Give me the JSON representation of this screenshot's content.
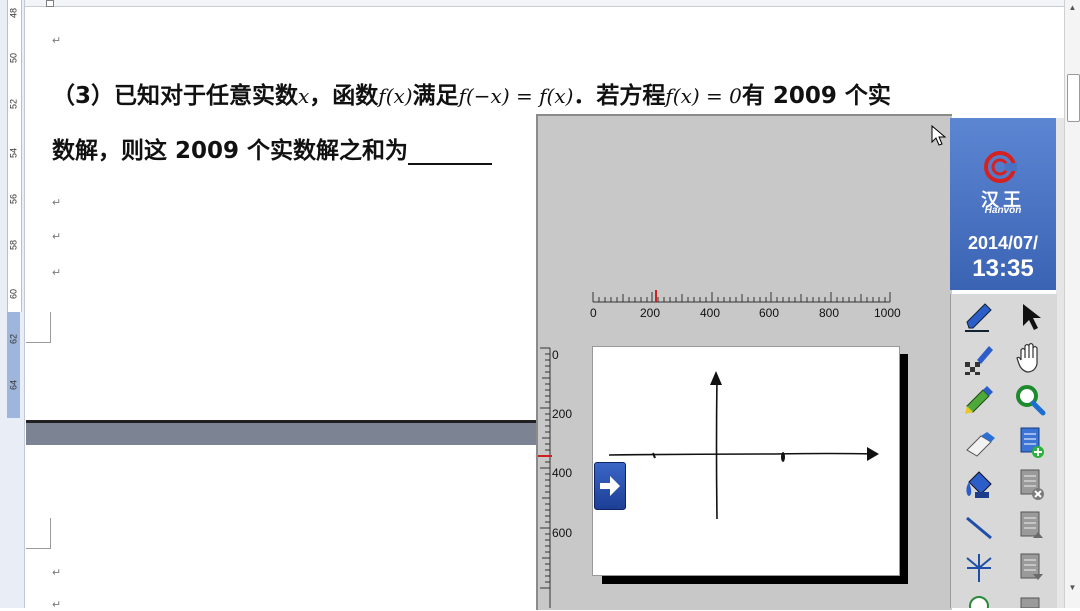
{
  "document": {
    "question_prefix": "（3）已知对于任意实数",
    "var_x": "x",
    "text_hanshu": "，函数",
    "fx": "f(x)",
    "text_manzu": "满足",
    "equation1": "f(−x) = f(x)",
    "text_fangcheng": "．若方程",
    "equation2": "f(x) = 0",
    "text_tail": "有 2009 个实",
    "line2": "数解，则这 2009 个实数解之和为",
    "para_mark": "↵"
  },
  "ruler_left": {
    "labels": [
      "48",
      "50",
      "52",
      "54",
      "56",
      "58",
      "60",
      "62",
      "64"
    ]
  },
  "board": {
    "h_ticks": [
      "0",
      "200",
      "400",
      "600",
      "800",
      "1000"
    ],
    "v_ticks": [
      "0",
      "200",
      "400",
      "600"
    ]
  },
  "brand": {
    "cn": "汉王",
    "en": "Hanvon",
    "date": "2014/07/",
    "time": "13:35"
  },
  "tools": [
    {
      "name": "pen-icon"
    },
    {
      "name": "pointer-icon"
    },
    {
      "name": "texture-pen-icon"
    },
    {
      "name": "hand-icon"
    },
    {
      "name": "highlighter-icon"
    },
    {
      "name": "magnifier-icon"
    },
    {
      "name": "eraser-icon"
    },
    {
      "name": "new-page-icon"
    },
    {
      "name": "fill-bucket-icon"
    },
    {
      "name": "delete-page-icon"
    },
    {
      "name": "line-icon"
    },
    {
      "name": "page-prev-icon"
    },
    {
      "name": "axes-tool-icon"
    },
    {
      "name": "page-next-icon"
    }
  ],
  "colors": {
    "brand_blue": "#4a72c2",
    "page_gap": "#7c8494",
    "accent_red": "#d22020"
  }
}
